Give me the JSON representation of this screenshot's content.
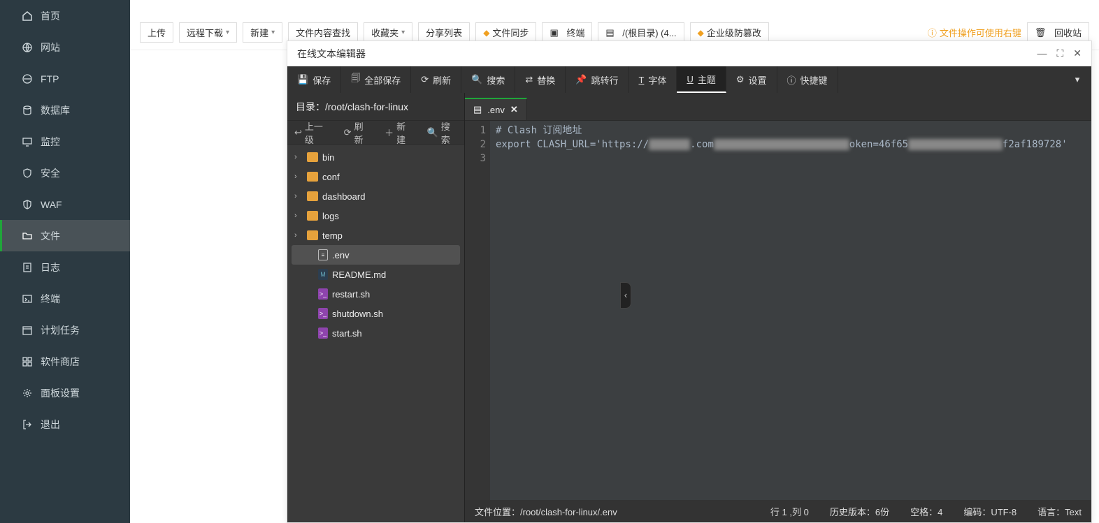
{
  "sidebar": {
    "items": [
      {
        "label": "首页",
        "icon": "home-icon"
      },
      {
        "label": "网站",
        "icon": "globe-icon"
      },
      {
        "label": "FTP",
        "icon": "ftp-icon"
      },
      {
        "label": "数据库",
        "icon": "database-icon"
      },
      {
        "label": "监控",
        "icon": "monitor-icon"
      },
      {
        "label": "安全",
        "icon": "shield-icon"
      },
      {
        "label": "WAF",
        "icon": "waf-icon"
      },
      {
        "label": "文件",
        "icon": "folder-icon",
        "active": true
      },
      {
        "label": "日志",
        "icon": "log-icon"
      },
      {
        "label": "终端",
        "icon": "terminal-icon"
      },
      {
        "label": "计划任务",
        "icon": "calendar-icon"
      },
      {
        "label": "软件商店",
        "icon": "appstore-icon"
      },
      {
        "label": "面板设置",
        "icon": "settings-icon"
      },
      {
        "label": "退出",
        "icon": "exit-icon"
      }
    ]
  },
  "toolbar": {
    "upload": "上传",
    "remote_download": "远程下载",
    "new": "新建",
    "content_search": "文件内容查找",
    "favorites": "收藏夹",
    "share_list": "分享列表",
    "sync": "文件同步",
    "terminal": "终端",
    "root_dir": "/(根目录) (4...",
    "enterprise": "企业级防篡改",
    "hint": "文件操作可使用右键",
    "recycle": "回收站"
  },
  "editor_window": {
    "title": "在线文本编辑器",
    "toolbar": {
      "save": "保存",
      "save_all": "全部保存",
      "refresh": "刷新",
      "search": "搜索",
      "replace": "替换",
      "goto": "跳转行",
      "font": "字体",
      "theme": "主题",
      "settings": "设置",
      "shortcuts": "快捷键"
    },
    "file_panel": {
      "path_label": "目录：/root/clash-for-linux",
      "up": "上一级",
      "refresh": "刷新",
      "new": "新建",
      "search": "搜索",
      "tree": [
        {
          "type": "folder",
          "name": "bin"
        },
        {
          "type": "folder",
          "name": "conf"
        },
        {
          "type": "folder",
          "name": "dashboard"
        },
        {
          "type": "folder",
          "name": "logs"
        },
        {
          "type": "folder",
          "name": "temp"
        },
        {
          "type": "file",
          "name": ".env",
          "selected": true,
          "ic": "file"
        },
        {
          "type": "file",
          "name": "README.md",
          "ic": "md"
        },
        {
          "type": "file",
          "name": "restart.sh",
          "ic": "sh"
        },
        {
          "type": "file",
          "name": "shutdown.sh",
          "ic": "sh"
        },
        {
          "type": "file",
          "name": "start.sh",
          "ic": "sh"
        }
      ]
    },
    "tab_label": ".env",
    "code_lines": [
      "# Clash 订阅地址",
      "export CLASH_URL='https://███████.com███████████████████████oken=46f65████████████████f2af189728'",
      ""
    ],
    "statusbar": {
      "location": "文件位置：/root/clash-for-linux/.env",
      "cursor": "行 1 ,列 0",
      "history": "历史版本：6份",
      "spaces": "空格：4",
      "encoding": "编码：UTF-8",
      "language": "语言：Text"
    }
  }
}
